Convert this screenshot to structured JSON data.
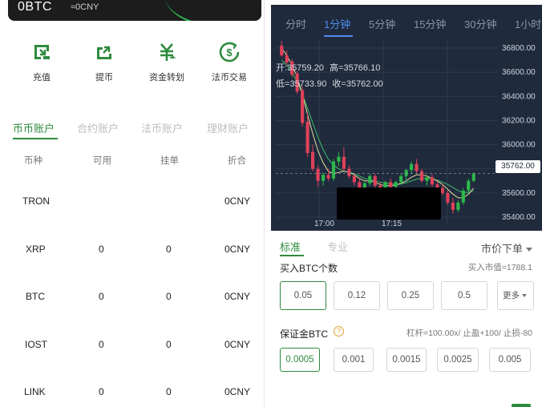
{
  "wallet": {
    "balance": "0BTC",
    "approx": "≈0CNY",
    "actions": [
      {
        "label": "充值",
        "icon": "deposit-icon"
      },
      {
        "label": "提币",
        "icon": "withdraw-icon"
      },
      {
        "label": "资金转划",
        "icon": "transfer-icon"
      },
      {
        "label": "法币交易",
        "icon": "fiat-trade-icon"
      }
    ],
    "account_tabs": [
      "币币账户",
      "合约账户",
      "法币账户",
      "理财账户"
    ],
    "table_headers": [
      "币种",
      "可用",
      "挂单",
      "折合"
    ],
    "rows": [
      {
        "coin": "TRON",
        "available": "",
        "orders": "",
        "value": "0CNY"
      },
      {
        "coin": "XRP",
        "available": "0",
        "orders": "0",
        "value": "0CNY"
      },
      {
        "coin": "BTC",
        "available": "0",
        "orders": "0",
        "value": "0CNY"
      },
      {
        "coin": "IOST",
        "available": "0",
        "orders": "0",
        "value": "0CNY"
      },
      {
        "coin": "LINK",
        "available": "0",
        "orders": "0",
        "value": "0CNY"
      }
    ]
  },
  "chart": {
    "periods": [
      "分时",
      "1分钟",
      "5分钟",
      "15分钟",
      "30分钟",
      "1小时"
    ],
    "active_period": "1分钟",
    "ohlc": {
      "open_label": "开:",
      "open": "35759.20",
      "high_label": "高=",
      "high": "35766.10",
      "low_label": "低=",
      "low": "35733.90",
      "close_label": "收=",
      "close": "35762.00"
    },
    "current_price": "35762.00",
    "x_labels": [
      "17:00",
      "17:15"
    ],
    "colors": {
      "up": "#2db84c",
      "down": "#e0415a",
      "background": "#1f2a3c",
      "ma1": "#e8e0a0",
      "ma2": "#3fbf6a"
    }
  },
  "chart_data": {
    "type": "candlestick",
    "y_ticks": [
      35400,
      35600,
      35800,
      36000,
      36200,
      36400,
      36600,
      36800
    ],
    "ylim": [
      35340,
      36880
    ],
    "x_labels": [
      "17:00",
      "17:15"
    ],
    "candles": [
      [
        36820,
        36860,
        36730,
        36740
      ],
      [
        36740,
        36780,
        36660,
        36680
      ],
      [
        36690,
        36710,
        36560,
        36580
      ],
      [
        36590,
        36610,
        36420,
        36440
      ],
      [
        36450,
        36480,
        36150,
        36180
      ],
      [
        36190,
        36260,
        35900,
        35930
      ],
      [
        35940,
        36000,
        35780,
        35800
      ],
      [
        35800,
        35830,
        35650,
        35700
      ],
      [
        35700,
        35770,
        35660,
        35750
      ],
      [
        35750,
        35800,
        35700,
        35720
      ],
      [
        35720,
        35880,
        35700,
        35860
      ],
      [
        35860,
        35940,
        35820,
        35900
      ],
      [
        35900,
        35980,
        35780,
        35800
      ],
      [
        35800,
        35830,
        35720,
        35740
      ],
      [
        35740,
        35760,
        35660,
        35690
      ],
      [
        35690,
        35720,
        35620,
        35640
      ],
      [
        35640,
        35700,
        35600,
        35680
      ],
      [
        35680,
        35760,
        35660,
        35740
      ],
      [
        35740,
        35760,
        35640,
        35660
      ],
      [
        35660,
        35690,
        35590,
        35620
      ],
      [
        35620,
        35700,
        35600,
        35690
      ],
      [
        35690,
        35720,
        35640,
        35650
      ],
      [
        35650,
        35700,
        35620,
        35690
      ],
      [
        35690,
        35760,
        35670,
        35740
      ],
      [
        35740,
        35800,
        35700,
        35790
      ],
      [
        35790,
        35860,
        35760,
        35840
      ],
      [
        35840,
        35880,
        35760,
        35780
      ],
      [
        35780,
        35800,
        35690,
        35700
      ],
      [
        35700,
        35740,
        35660,
        35730
      ],
      [
        35730,
        35760,
        35650,
        35670
      ],
      [
        35670,
        35700,
        35600,
        35640
      ],
      [
        35640,
        35680,
        35580,
        35600
      ],
      [
        35600,
        35620,
        35500,
        35520
      ],
      [
        35520,
        35560,
        35430,
        35460
      ],
      [
        35460,
        35540,
        35440,
        35520
      ],
      [
        35520,
        35640,
        35500,
        35620
      ],
      [
        35620,
        35720,
        35600,
        35700
      ],
      [
        35700,
        35770,
        35690,
        35760
      ]
    ],
    "ma1": [
      36800,
      36740,
      36660,
      36560,
      36420,
      36250,
      36090,
      35950,
      35850,
      35780,
      35760,
      35770,
      35780,
      35770,
      35750,
      35720,
      35700,
      35700,
      35690,
      35670,
      35660,
      35660,
      35665,
      35680,
      35700,
      35730,
      35750,
      35750,
      35740,
      35720,
      35700,
      35670,
      35630,
      35590,
      35560,
      35560,
      35590,
      35640
    ],
    "ma2": [
      36700,
      36660,
      36600,
      36520,
      36420,
      36300,
      36180,
      36060,
      35960,
      35880,
      35830,
      35800,
      35780,
      35770,
      35760,
      35740,
      35720,
      35710,
      35700,
      35690,
      35680,
      35675,
      35670,
      35675,
      35685,
      35700,
      35715,
      35720,
      35720,
      35715,
      35705,
      35690,
      35670,
      35645,
      35620,
      35605,
      35605,
      35620
    ]
  },
  "order": {
    "tabs": [
      "标准",
      "专业"
    ],
    "order_type": "市价下单",
    "buy_label": "买入BTC个数",
    "market_value": "买入市值=1788.1",
    "quantities": [
      "0.05",
      "0.12",
      "0.25",
      "0.5"
    ],
    "more_label": "更多",
    "margin_label": "保证金BTC",
    "help_symbol": "?",
    "leverage_info": "杠杆=100.00x/ 止盈+100/ 止损-80",
    "margins": [
      "0.0005",
      "0.001",
      "0.0015",
      "0.0025",
      "0.005"
    ]
  }
}
